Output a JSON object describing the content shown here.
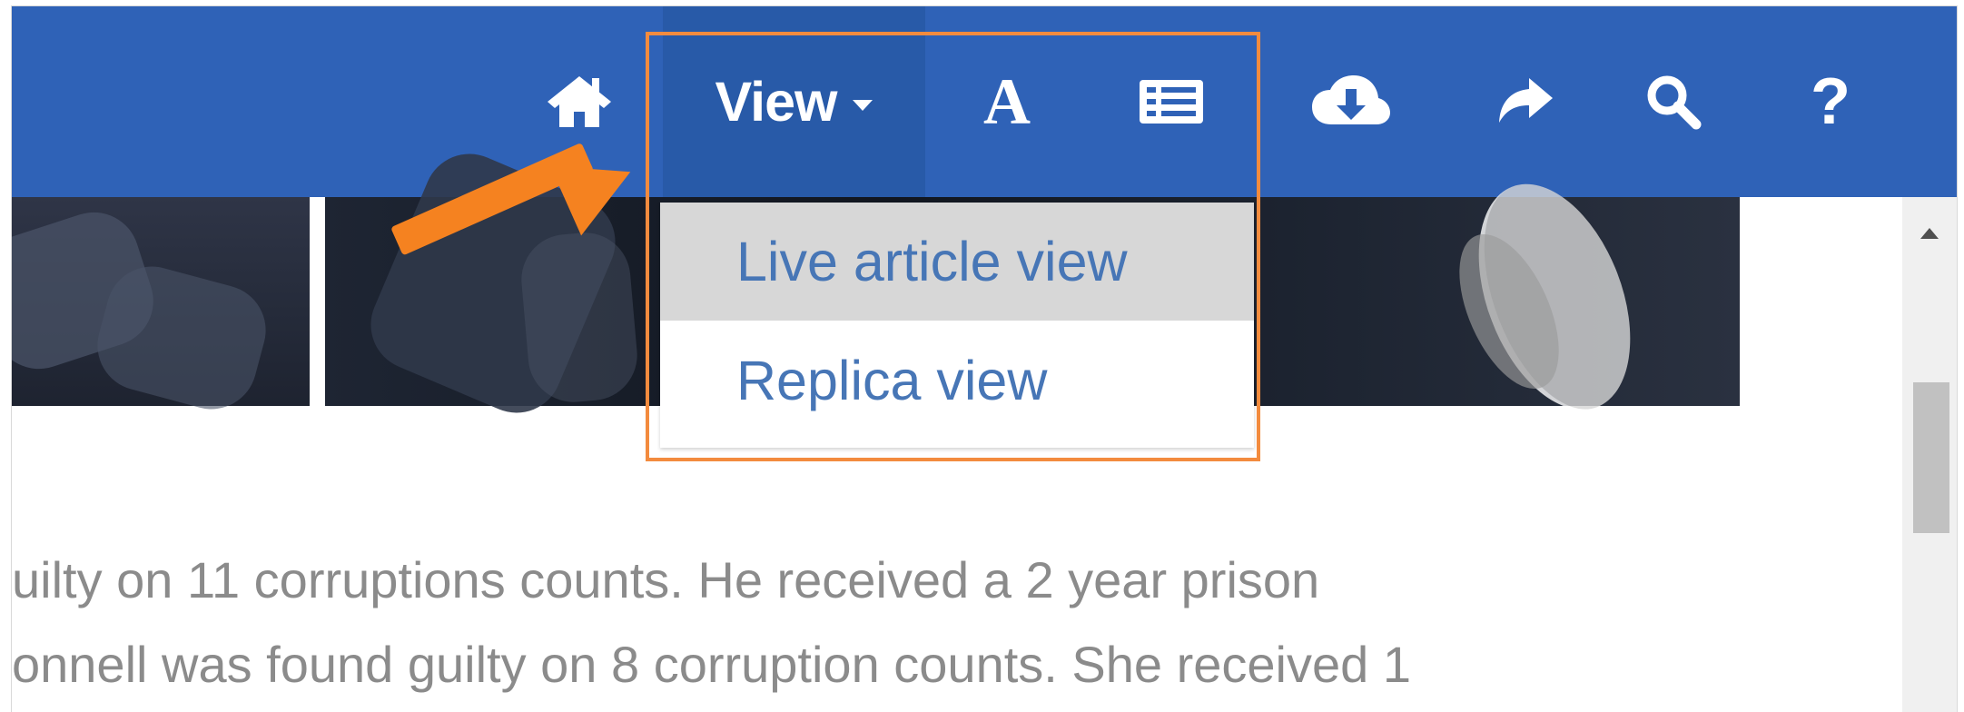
{
  "toolbar": {
    "home_icon": "home-icon",
    "view_label": "View",
    "view_caret_icon": "caret-down-icon",
    "text_size_label": "A",
    "list_icon": "list-icon",
    "cloud_download_icon": "cloud-download-icon",
    "share_icon": "share-icon",
    "search_icon": "search-icon",
    "help_label": "?"
  },
  "dropdown": {
    "items": [
      {
        "label": "Live article view",
        "active": true
      },
      {
        "label": "Replica view",
        "active": false
      }
    ]
  },
  "article": {
    "lines": [
      "uilty on 11 corruptions counts. He received a 2 year prison",
      "onnell was found guilty on 8 corruption counts. She received 1"
    ]
  },
  "colors": {
    "toolbar_blue": "#2f62b7",
    "menu_text_blue": "#4776b6",
    "highlight_orange": "#f38b3e",
    "article_text_gray": "#8b8b8b"
  }
}
